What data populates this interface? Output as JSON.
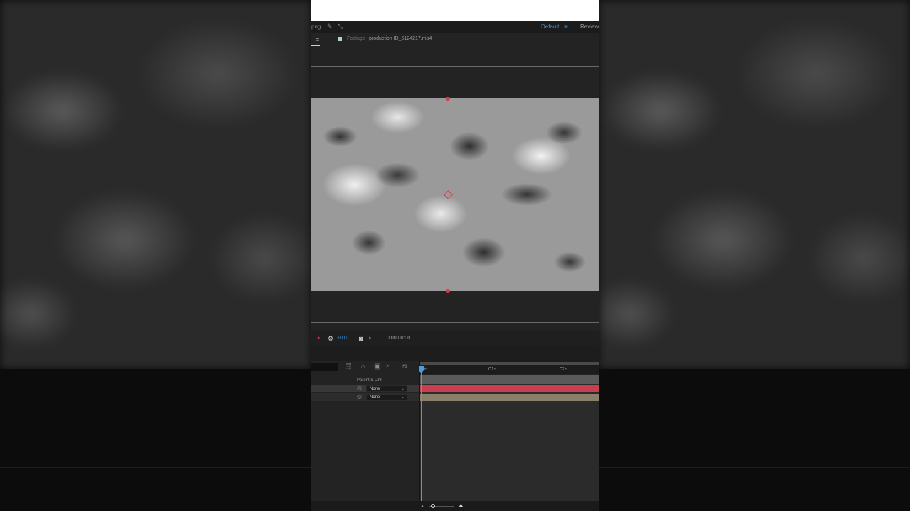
{
  "topbar": {
    "file_ext": "png",
    "workspace_default": "Default",
    "workspace_menu": "≡",
    "workspace_review": "Review"
  },
  "panel": {
    "menu_glyph": "≡",
    "footage_label": "Footage",
    "footage_name": "production ID_5124217.mp4"
  },
  "viewer_controls": {
    "exposure": "+0.0",
    "timecode": "0:00:00:00"
  },
  "timeline": {
    "ruler_labels": [
      "0s",
      "01s",
      "02s"
    ],
    "parent_link_header": "Parent & Link",
    "layers": [
      {
        "parent": "None",
        "bar_color": "#c8404f"
      },
      {
        "parent": "None",
        "bar_color": "#8a7f6a"
      }
    ]
  },
  "colors": {
    "accent": "#3d8fd6",
    "playhead": "#4a9ee0",
    "anchor": "#d23c4b"
  }
}
